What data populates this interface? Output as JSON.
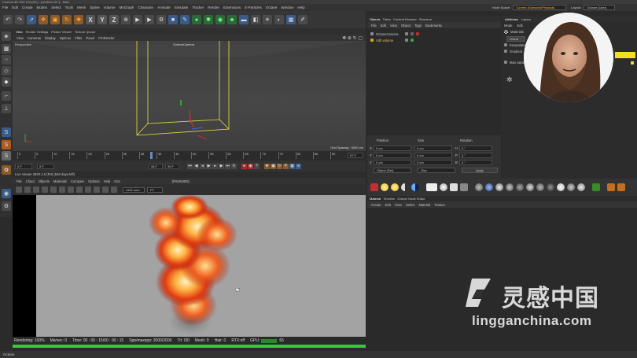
{
  "window": {
    "title": "Cinema 4D S22.123 (RC) - [Untitled 18 *] - Main"
  },
  "menu": {
    "items": [
      "File",
      "Edit",
      "Create",
      "Modes",
      "Select",
      "Tools",
      "Mesh",
      "Spline",
      "Volume",
      "MoGraph",
      "Character",
      "Animate",
      "Simulate",
      "Tracker",
      "Render",
      "Extensions",
      "X-Particles",
      "Octane",
      "Window",
      "Help"
    ],
    "node_space_label": "Node Space:",
    "node_space_value": "Current (Standard/Physical)",
    "layout_label": "Layout:",
    "layout_value": "Octane (User)"
  },
  "toolbar": {
    "x_label": "X",
    "y_label": "Y",
    "z_label": "Z"
  },
  "viewport": {
    "tabs": [
      "View",
      "Render Settings",
      "Picture Viewer",
      "Texture Queue"
    ],
    "menu": [
      "View",
      "Cameras",
      "Display",
      "Options",
      "Filter",
      "Panel",
      "ProRender"
    ],
    "perspective_label": "Perspective",
    "camera_label": "OctaneCamera",
    "grid_spacing": "Grid Spacing : 5000 cm"
  },
  "timeline": {
    "ticks": [
      "0",
      "5",
      "10",
      "15",
      "20",
      "25",
      "30",
      "35",
      "40",
      "45",
      "50",
      "55",
      "60",
      "65",
      "70",
      "75",
      "80",
      "85",
      "90"
    ],
    "end_frame": "97 F",
    "current_frame": "0 F",
    "start_field": "0 F",
    "min_field": "0 F",
    "max_field": "96 F",
    "end_field": "96 F"
  },
  "live_viewer": {
    "title": "Live Viewer 2020.1.5 (R4) (540 days left)",
    "menu": [
      "File",
      "Cloud",
      "Objects",
      "Materials",
      "Compare",
      "Options",
      "Help",
      "GUI"
    ],
    "mode": "[FINISHED]",
    "tonemap": "HDR tone",
    "preset": "PT",
    "status": {
      "rendering": "Rendering: 100%",
      "ms_sec": "Ms/sec: 0",
      "time": "Time: 00 : 00 : 15/00 : 00 : 15",
      "spp": "Spp/maxspp: 2000/2000",
      "tri": "Tri: 0/0",
      "mesh": "Mesh: 0",
      "hair": "Hair: 0",
      "rtx": "RTX:off",
      "gpu": "GPU:",
      "gpu_val": "65"
    },
    "progress_pct": 100
  },
  "objects": {
    "tabs": [
      "Objects",
      "Takes",
      "Content Browser",
      "Structure"
    ],
    "menu": [
      "File",
      "Edit",
      "View",
      "Object",
      "Tags",
      "Bookmarks"
    ],
    "items": [
      "OctaneCamera",
      "Vdb volume"
    ]
  },
  "coordinates": {
    "headers": [
      "Position",
      "Size",
      "Rotation"
    ],
    "rows": [
      {
        "axis": "X",
        "pos": "0 cm",
        "size": "0 cm",
        "rot_axis": "H",
        "rot": "0 °"
      },
      {
        "axis": "Y",
        "pos": "0 cm",
        "size": "0 cm",
        "rot_axis": "P",
        "rot": "0 °"
      },
      {
        "axis": "Z",
        "pos": "0 cm",
        "size": "0 cm",
        "rot_axis": "B",
        "rot": "0 °"
      }
    ],
    "mode_value": "Object (Rel)",
    "size_mode": "Size",
    "apply": "Apply"
  },
  "attributes": {
    "tabs": [
      "Attributes",
      "Layers"
    ],
    "menu": [
      "Mode",
      "Edit"
    ],
    "title": "Materials",
    "button": "Linear",
    "rows": [
      "Interpolation",
      "Gradient",
      "Max value"
    ]
  },
  "materials": {
    "tabs": [
      "Material",
      "Timeline",
      "Octane Node Editor"
    ],
    "menu": [
      "Create",
      "Edit",
      "View",
      "Select",
      "Material",
      "Texture"
    ]
  },
  "bottom_bar": {
    "label": "Octane"
  },
  "watermark": {
    "text": "灵感中国",
    "url": "lingganchina.com"
  }
}
